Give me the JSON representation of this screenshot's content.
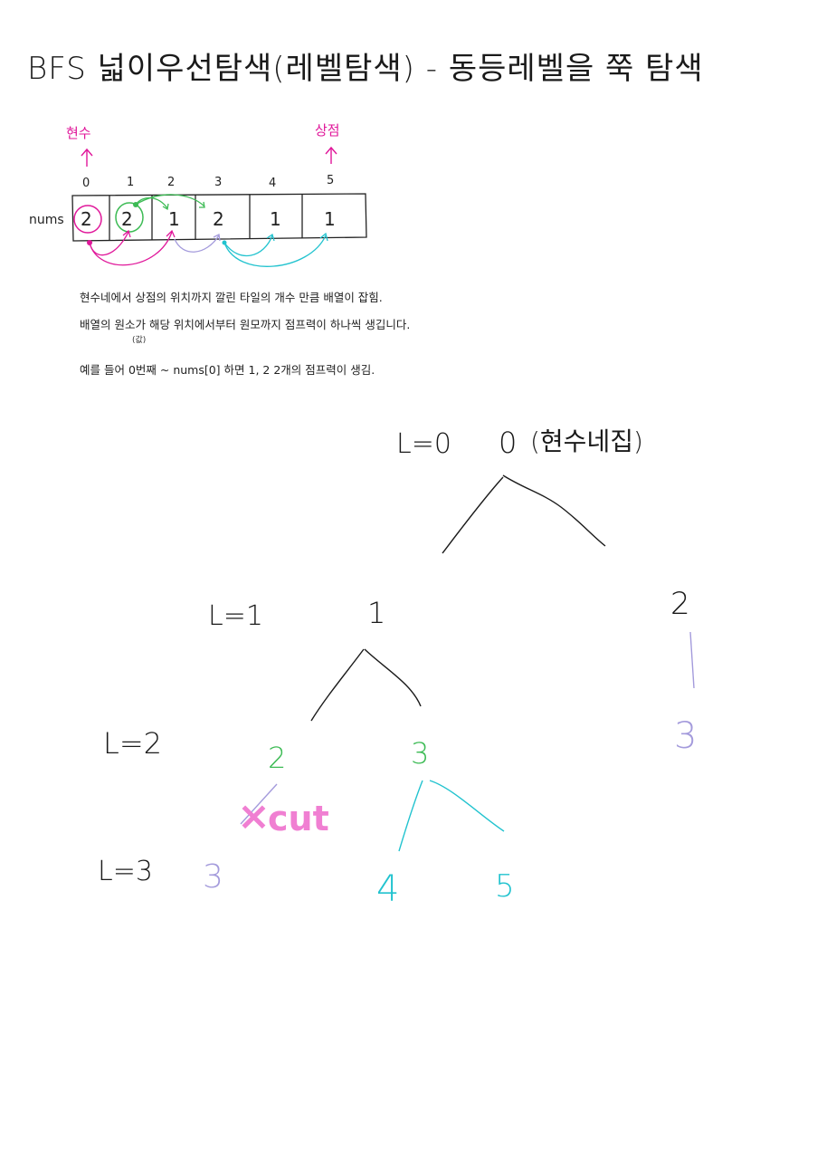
{
  "title": "BFS 넓이우선탐색(레벨탐색) - 동등레벨을 쭉 탐색",
  "array": {
    "label": "nums",
    "indices": [
      "0",
      "1",
      "2",
      "3",
      "4",
      "5"
    ],
    "values": [
      "2",
      "2",
      "1",
      "2",
      "1",
      "1"
    ],
    "start_label": "현수",
    "end_label": "상점"
  },
  "notes": {
    "line1": "현수네에서 상점의 위치까지 깔린 타일의 개수 만큼 배열이 잡힘.",
    "line2": "배열의 원소가  해당 위치에서부터 원모까지 점프력이 하나씩 생깁니다.",
    "line2_sub": "(값)",
    "line3": "예를 들어 0번째 ~ nums[0] 하면  1, 2  2개의 점프력이 생김."
  },
  "tree": {
    "levels": [
      "L=0",
      "L=1",
      "L=2",
      "L=3"
    ],
    "root": "0",
    "root_note": "(현수네집)",
    "l1_nodes": [
      "1",
      "2"
    ],
    "l2_nodes": [
      "2",
      "3",
      "3"
    ],
    "l3_nodes": [
      "3",
      "4",
      "5"
    ],
    "cut_label": "cut"
  },
  "colors": {
    "ink": "#1a1a1a",
    "pink": "#e0179a",
    "green": "#3dbb55",
    "cyan": "#22c3cf",
    "lavender": "#a49bdc",
    "cut_highlight": "#f07fd2"
  }
}
